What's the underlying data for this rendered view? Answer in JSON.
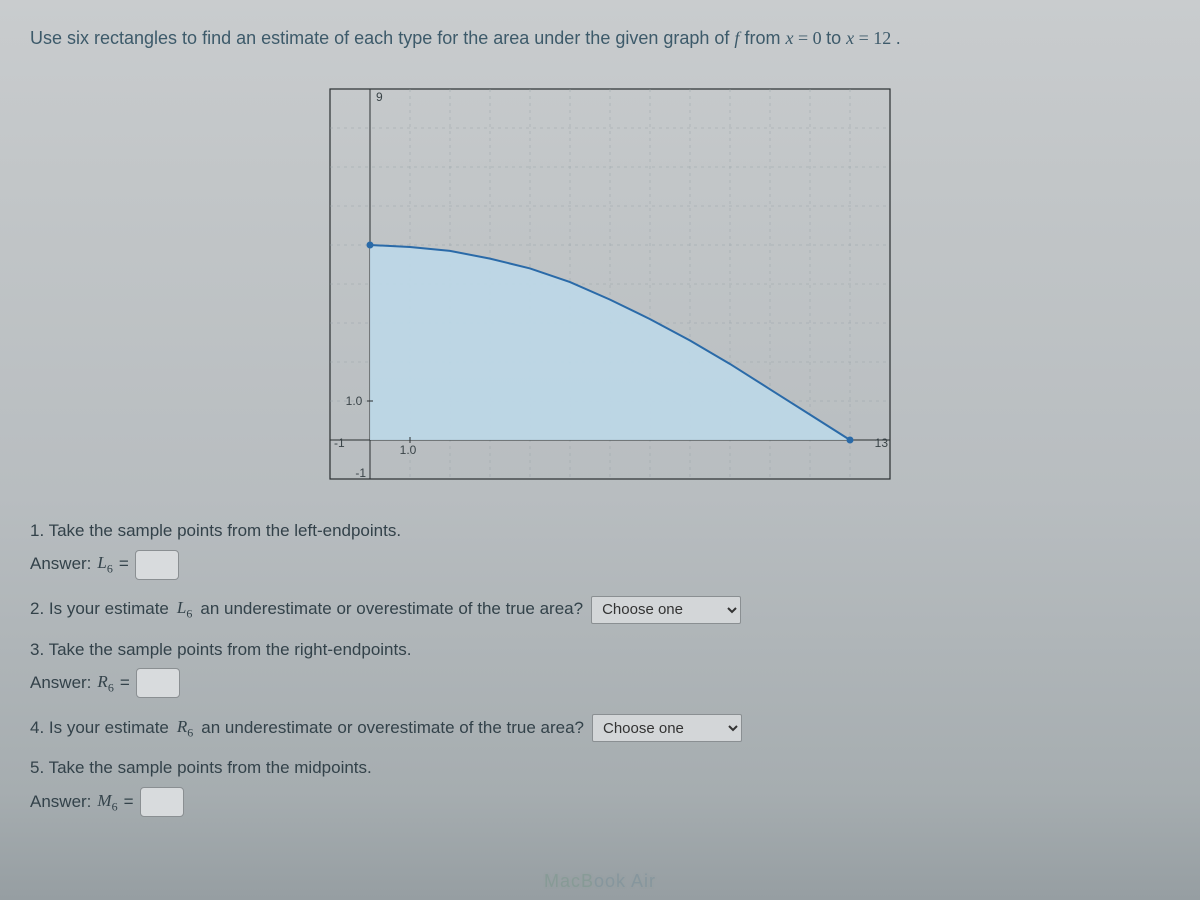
{
  "prompt": {
    "prefix": "Use six rectangles to find an estimate of each type for the area under the given graph of ",
    "fvar": "f",
    "mid": " from ",
    "eq1_lhs": "x",
    "eq1_rhs": "0",
    "to": " to ",
    "eq2_lhs": "x",
    "eq2_rhs": "12",
    "suffix": "."
  },
  "chart_data": {
    "type": "area",
    "x": [
      0,
      1,
      2,
      3,
      4,
      5,
      6,
      7,
      8,
      9,
      10,
      11,
      12
    ],
    "y": [
      5,
      4.95,
      4.85,
      4.65,
      4.4,
      4.05,
      3.6,
      3.1,
      2.55,
      1.95,
      1.3,
      0.65,
      0
    ],
    "title": "",
    "xlabel": "",
    "ylabel": "",
    "xlim": [
      -1,
      13
    ],
    "ylim": [
      -1,
      9
    ],
    "x_ticks_major": [
      1
    ],
    "x_tick_labels": {
      "neg1": "-1",
      "one": "1.0",
      "thirteen": "13"
    },
    "y_ticks_major": [
      1
    ],
    "y_tick_labels": {
      "neg1": "-1",
      "one": "1.0",
      "nine": "9"
    },
    "area_color": "#bcd8e8",
    "curve_color": "#2a6aa8",
    "curve_width": 2
  },
  "questions": {
    "q1": "1. Take the sample points from the left-endpoints.",
    "a1_label": "Answer:",
    "a1_sym": "L",
    "a1_sub": "6",
    "eqsym": "=",
    "q2_pre": "2. Is your estimate ",
    "q2_sym": "L",
    "q2_sub": "6",
    "q2_post": " an underestimate or overestimate of the true area?",
    "q3": "3. Take the sample points from the right-endpoints.",
    "a3_label": "Answer:",
    "a3_sym": "R",
    "a3_sub": "6",
    "q4_pre": "4. Is your estimate ",
    "q4_sym": "R",
    "q4_sub": "6",
    "q4_post": " an underestimate or overestimate of the true area?",
    "q5": "5. Take the sample points from the midpoints.",
    "a5_label": "Answer:",
    "a5_sym": "M",
    "a5_sub": "6",
    "choose_placeholder": "Choose one"
  },
  "watermark": {
    "part1": "MacB",
    "part2": "ook Air"
  }
}
